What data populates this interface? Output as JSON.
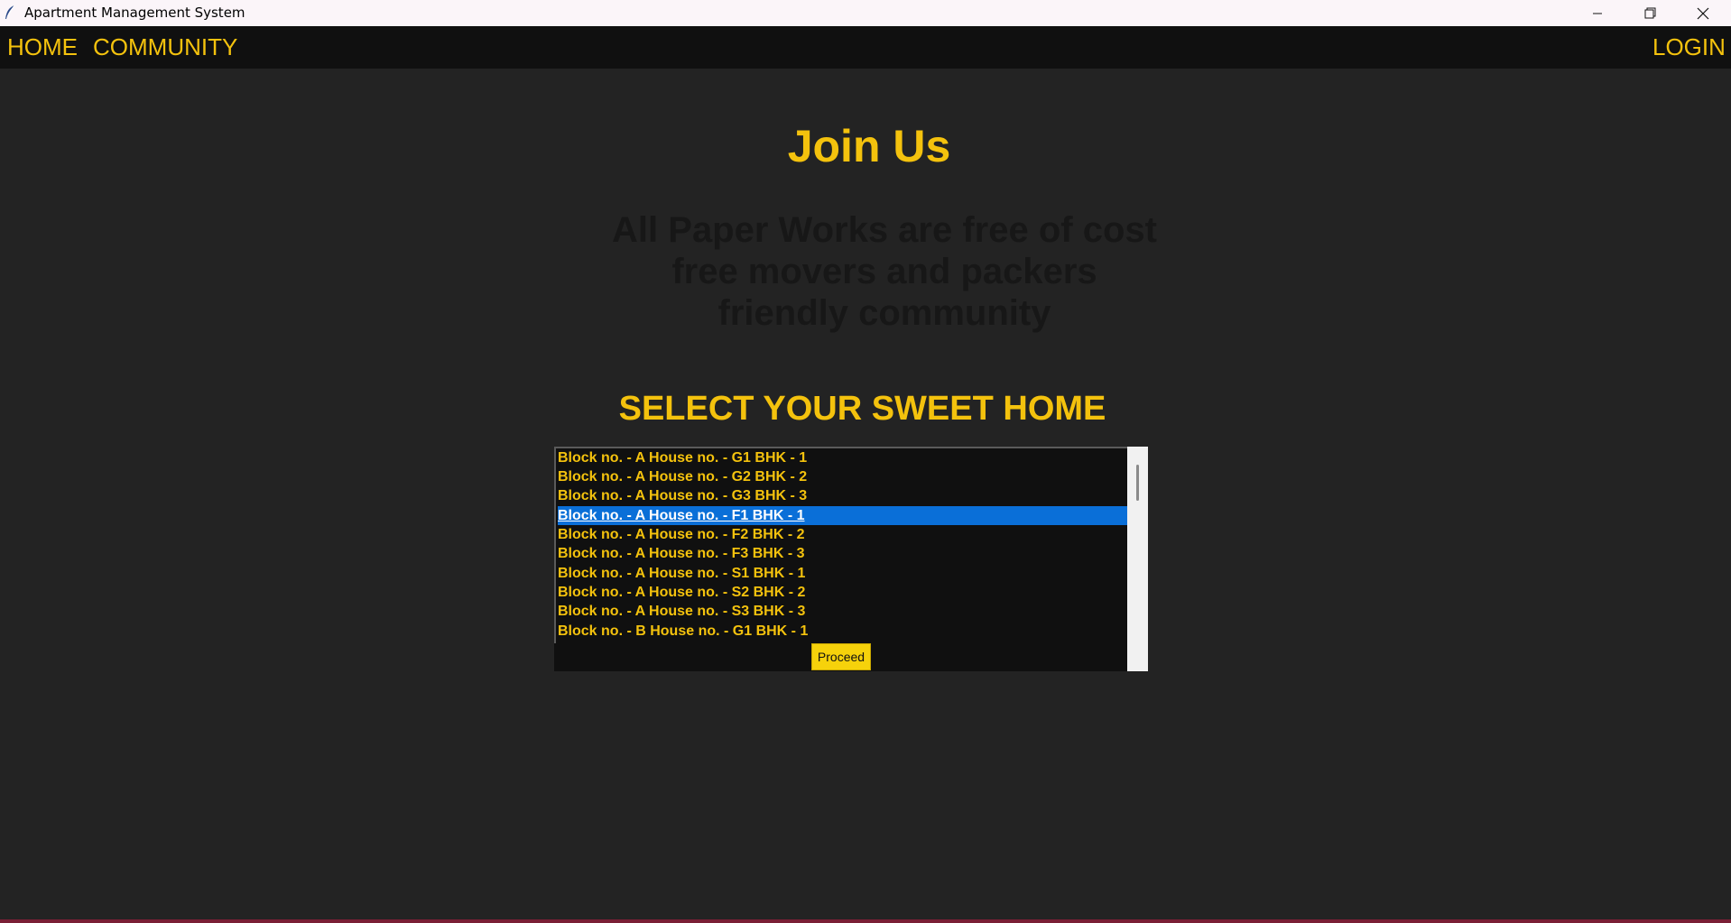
{
  "window": {
    "title": "Apartment Management System"
  },
  "navbar": {
    "home": "HOME",
    "community": "COMMUNITY",
    "login": "LOGIN"
  },
  "main": {
    "heading": "Join Us",
    "taglines": [
      "All Paper Works are free of cost",
      "free movers and packers",
      "friendly community"
    ],
    "select_heading": "SELECT YOUR SWEET HOME",
    "houses": [
      "Block no. - A House no. - G1 BHK - 1",
      "Block no. - A House no. - G2 BHK - 2",
      "Block no. - A House no. - G3 BHK - 3",
      "Block no. - A House no. - F1 BHK - 1",
      "Block no. - A House no. - F2 BHK - 2",
      "Block no. - A House no. - F3 BHK - 3",
      "Block no. - A House no. - S1 BHK - 1",
      "Block no. - A House no. - S2 BHK - 2",
      "Block no. - A House no. - S3 BHK - 3",
      "Block no. - B House no. - G1 BHK - 1"
    ],
    "selected_house": "Block no. - A House no. - F1 BHK - 1",
    "proceed_label": "Proceed"
  },
  "colors": {
    "accent": "#f4c20d",
    "background": "#232323",
    "navbar": "#101010",
    "selection": "#0a6fd8"
  },
  "icons": {
    "app": "feather-icon",
    "minimize": "minimize-icon",
    "restore": "restore-icon",
    "close": "close-icon"
  }
}
